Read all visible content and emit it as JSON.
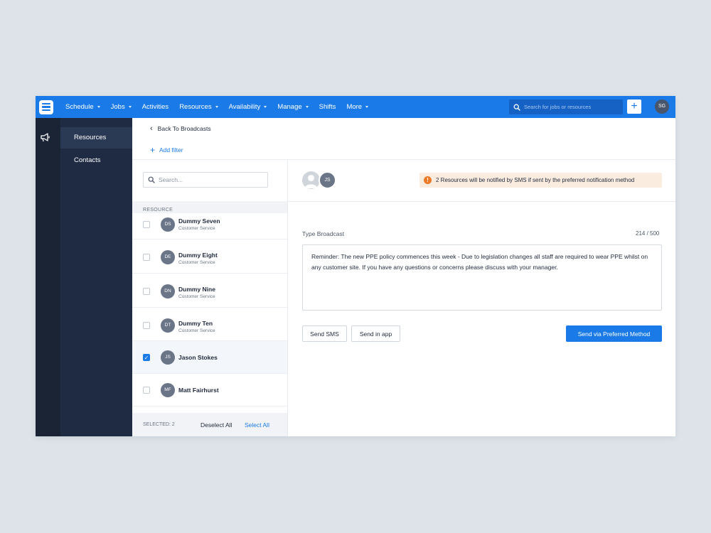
{
  "topbar": {
    "nav": [
      {
        "label": "Schedule",
        "caret": true
      },
      {
        "label": "Jobs",
        "caret": true
      },
      {
        "label": "Activities",
        "caret": false
      },
      {
        "label": "Resources",
        "caret": true
      },
      {
        "label": "Availability",
        "caret": true
      },
      {
        "label": "Manage",
        "caret": true
      },
      {
        "label": "Shifts",
        "caret": false
      },
      {
        "label": "More",
        "caret": true
      }
    ],
    "search_placeholder": "Search for jobs or resources",
    "add_label": "+",
    "user_initials": "SG"
  },
  "subnav": {
    "items": [
      "Resources",
      "Contacts"
    ],
    "active": "Resources"
  },
  "content": {
    "back_label": "Back To Broadcasts",
    "add_filter_label": "Add filter",
    "list": {
      "search_placeholder": "Search...",
      "header": "RESOURCE",
      "rows": [
        {
          "initials": "DS",
          "name": "Dummy Seven",
          "role": "Customer Service",
          "checked": false
        },
        {
          "initials": "DE",
          "name": "Dummy Eight",
          "role": "Customer Service",
          "checked": false
        },
        {
          "initials": "DN",
          "name": "Dummy Nine",
          "role": "Customer Service",
          "checked": false
        },
        {
          "initials": "DT",
          "name": "Dummy Ten",
          "role": "Customer Service",
          "checked": false
        },
        {
          "initials": "JS",
          "name": "Jason Stokes",
          "role": "",
          "checked": true
        },
        {
          "initials": "MF",
          "name": "Matt Fairhurst",
          "role": "",
          "checked": false
        }
      ],
      "selected_label": "SELECTED: 2",
      "deselect_all": "Deselect All",
      "select_all": "Select All"
    },
    "broadcast": {
      "recipient_initials": "JS",
      "notice": "2 Resources will be notified by SMS if sent by the preferred notification method",
      "notice_icon": "!",
      "type_label": "Type Broadcast",
      "counter": "214 / 500",
      "message": "Reminder: The new PPE policy commences this week - Due to legislation changes all staff are required to wear PPE whilst on any customer site. If you have any questions or concerns please discuss with your manager.",
      "send_sms": "Send SMS",
      "send_app": "Send in app",
      "send_preferred": "Send via Preferred Method"
    }
  },
  "colors": {
    "brand": "#1a7ae8",
    "rail": "#1a2435",
    "subnav": "#1e2b42",
    "warning": "#ec7a26",
    "notice_bg": "#fbece0"
  }
}
